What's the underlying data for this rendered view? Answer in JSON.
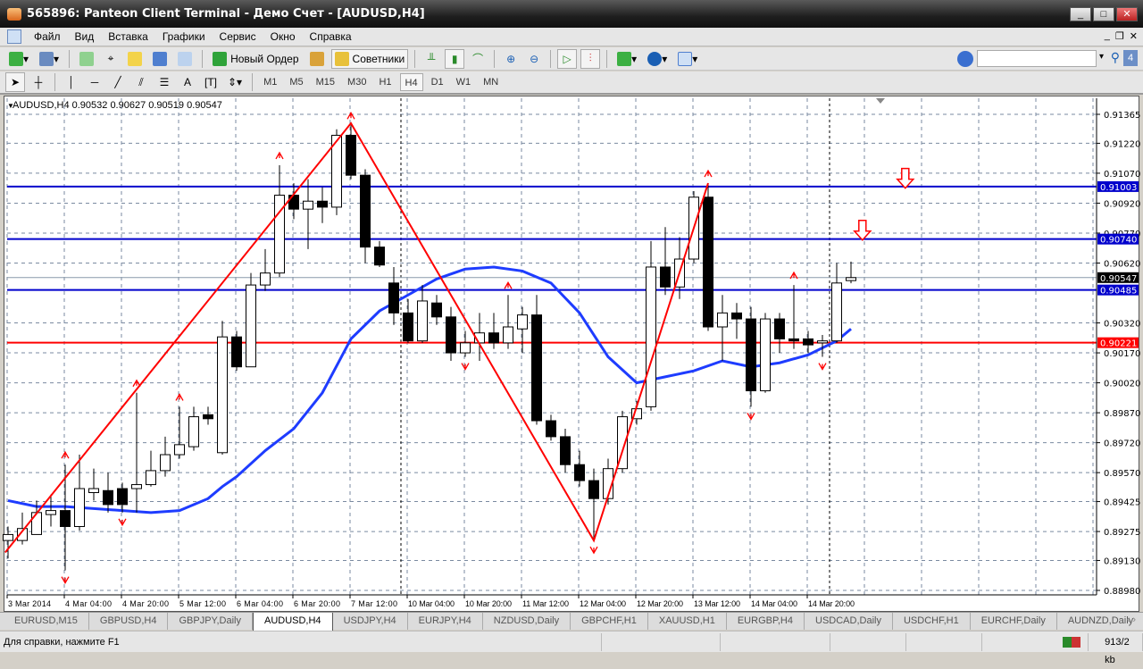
{
  "window": {
    "title": "565896: Panteon Client Terminal - Демо Счет - [AUDUSD,H4]"
  },
  "menu": [
    "Файл",
    "Вид",
    "Вставка",
    "Графики",
    "Сервис",
    "Окно",
    "Справка"
  ],
  "toolbar": {
    "new_order": "Новый Ордер",
    "experts": "Советники",
    "search_placeholder": "",
    "badge": "4"
  },
  "timeframes": [
    "M1",
    "M5",
    "M15",
    "M30",
    "H1",
    "H4",
    "D1",
    "W1",
    "MN"
  ],
  "active_timeframe": "H4",
  "chart_data": {
    "type": "candlestick",
    "symbol_header": "AUDUSD,H4  0.90532 0.90627 0.90519 0.90547",
    "ylim": [
      0.8898,
      0.91365
    ],
    "y_ticks": [
      "0.91365",
      "0.91220",
      "0.91070",
      "0.90920",
      "0.90770",
      "0.90620",
      "0.90320",
      "0.90170",
      "0.90020",
      "0.89870",
      "0.89720",
      "0.89570",
      "0.89425",
      "0.89275",
      "0.89130",
      "0.88980"
    ],
    "x_ticks": [
      {
        "i": 0,
        "label": "3 Mar 2014"
      },
      {
        "i": 4,
        "label": "4 Mar 04:00"
      },
      {
        "i": 8,
        "label": "4 Mar 20:00"
      },
      {
        "i": 12,
        "label": "5 Mar 12:00"
      },
      {
        "i": 16,
        "label": "6 Mar 04:00"
      },
      {
        "i": 20,
        "label": "6 Mar 20:00"
      },
      {
        "i": 24,
        "label": "7 Mar 12:00"
      },
      {
        "i": 28,
        "label": "10 Mar 04:00"
      },
      {
        "i": 32,
        "label": "10 Mar 20:00"
      },
      {
        "i": 36,
        "label": "11 Mar 12:00"
      },
      {
        "i": 40,
        "label": "12 Mar 04:00"
      },
      {
        "i": 44,
        "label": "12 Mar 20:00"
      },
      {
        "i": 48,
        "label": "13 Mar 12:00"
      },
      {
        "i": 52,
        "label": "14 Mar 04:00"
      },
      {
        "i": 56,
        "label": "14 Mar 20:00"
      }
    ],
    "ohlc": [
      [
        0.8923,
        0.893,
        0.8914,
        0.8926
      ],
      [
        0.8923,
        0.8937,
        0.8921,
        0.8929
      ],
      [
        0.8926,
        0.8943,
        0.8926,
        0.8937
      ],
      [
        0.8936,
        0.8946,
        0.893,
        0.8938
      ],
      [
        0.8938,
        0.8961,
        0.8908,
        0.893
      ],
      [
        0.893,
        0.8966,
        0.8928,
        0.8949
      ],
      [
        0.8947,
        0.8959,
        0.8943,
        0.8949
      ],
      [
        0.8948,
        0.8957,
        0.8937,
        0.8941
      ],
      [
        0.8949,
        0.8952,
        0.8937,
        0.8941
      ],
      [
        0.8949,
        0.8997,
        0.8937,
        0.8951
      ],
      [
        0.8951,
        0.8968,
        0.895,
        0.8958
      ],
      [
        0.8958,
        0.8975,
        0.8955,
        0.8966
      ],
      [
        0.8966,
        0.899,
        0.8964,
        0.8971
      ],
      [
        0.897,
        0.899,
        0.8968,
        0.8985
      ],
      [
        0.8986,
        0.899,
        0.8981,
        0.8984
      ],
      [
        0.8967,
        0.9033,
        0.8966,
        0.9025
      ],
      [
        0.9025,
        0.9028,
        0.9008,
        0.901
      ],
      [
        0.901,
        0.9057,
        0.901,
        0.9051
      ],
      [
        0.9051,
        0.9069,
        0.9048,
        0.9057
      ],
      [
        0.9057,
        0.9111,
        0.9055,
        0.9096
      ],
      [
        0.9096,
        0.9102,
        0.9084,
        0.9089
      ],
      [
        0.9089,
        0.9104,
        0.9069,
        0.9093
      ],
      [
        0.9093,
        0.91,
        0.9082,
        0.909
      ],
      [
        0.909,
        0.9129,
        0.9086,
        0.9126
      ],
      [
        0.9126,
        0.9131,
        0.9104,
        0.9106
      ],
      [
        0.9106,
        0.9109,
        0.9062,
        0.907
      ],
      [
        0.907,
        0.9073,
        0.906,
        0.9061
      ],
      [
        0.9052,
        0.906,
        0.9031,
        0.9037
      ],
      [
        0.9037,
        0.9044,
        0.9022,
        0.9023
      ],
      [
        0.9023,
        0.9051,
        0.9022,
        0.9043
      ],
      [
        0.9042,
        0.9046,
        0.9031,
        0.9035
      ],
      [
        0.9035,
        0.904,
        0.9013,
        0.9017
      ],
      [
        0.9017,
        0.9028,
        0.9015,
        0.9022
      ],
      [
        0.9022,
        0.9037,
        0.9013,
        0.9027
      ],
      [
        0.9027,
        0.9037,
        0.9019,
        0.9022
      ],
      [
        0.9022,
        0.9046,
        0.9019,
        0.903
      ],
      [
        0.9029,
        0.904,
        0.9017,
        0.9036
      ],
      [
        0.9036,
        0.9046,
        0.8981,
        0.8983
      ],
      [
        0.8983,
        0.8986,
        0.8973,
        0.8975
      ],
      [
        0.8975,
        0.8979,
        0.8957,
        0.8961
      ],
      [
        0.8961,
        0.8968,
        0.895,
        0.8953
      ],
      [
        0.8953,
        0.8959,
        0.8923,
        0.8944
      ],
      [
        0.8944,
        0.8964,
        0.8941,
        0.8959
      ],
      [
        0.8959,
        0.8988,
        0.8957,
        0.8985
      ],
      [
        0.8984,
        0.8993,
        0.8981,
        0.8989
      ],
      [
        0.899,
        0.9073,
        0.8988,
        0.906
      ],
      [
        0.906,
        0.908,
        0.9046,
        0.905
      ],
      [
        0.905,
        0.9075,
        0.9044,
        0.9064
      ],
      [
        0.9064,
        0.9098,
        0.9062,
        0.9095
      ],
      [
        0.9095,
        0.9102,
        0.9028,
        0.903
      ],
      [
        0.903,
        0.9046,
        0.9013,
        0.9037
      ],
      [
        0.9037,
        0.9042,
        0.9024,
        0.9034
      ],
      [
        0.9034,
        0.904,
        0.899,
        0.8998
      ],
      [
        0.8998,
        0.9037,
        0.8997,
        0.9034
      ],
      [
        0.9034,
        0.9037,
        0.9017,
        0.9024
      ],
      [
        0.9024,
        0.9051,
        0.9019,
        0.9023
      ],
      [
        0.9024,
        0.9028,
        0.9017,
        0.9021
      ],
      [
        0.9022,
        0.9026,
        0.9015,
        0.9023
      ],
      [
        0.9023,
        0.9062,
        0.9022,
        0.9052
      ],
      [
        0.90532,
        0.90627,
        0.90519,
        0.90547
      ]
    ],
    "moving_average": [
      [
        0,
        0.8943
      ],
      [
        2,
        0.894
      ],
      [
        4,
        0.894
      ],
      [
        6,
        0.8939
      ],
      [
        8,
        0.8938
      ],
      [
        10,
        0.8937
      ],
      [
        12,
        0.8938
      ],
      [
        14,
        0.8944
      ],
      [
        15,
        0.895
      ],
      [
        16,
        0.8955
      ],
      [
        18,
        0.8968
      ],
      [
        20,
        0.8979
      ],
      [
        22,
        0.8997
      ],
      [
        24,
        0.9024
      ],
      [
        26,
        0.9038
      ],
      [
        28,
        0.9046
      ],
      [
        30,
        0.9054
      ],
      [
        32,
        0.9059
      ],
      [
        34,
        0.906
      ],
      [
        36,
        0.9058
      ],
      [
        38,
        0.9052
      ],
      [
        40,
        0.9037
      ],
      [
        41,
        0.9026
      ],
      [
        42,
        0.9015
      ],
      [
        44,
        0.9002
      ],
      [
        46,
        0.9005
      ],
      [
        48,
        0.9008
      ],
      [
        50,
        0.9013
      ],
      [
        52,
        0.901
      ],
      [
        54,
        0.9012
      ],
      [
        56,
        0.9016
      ],
      [
        58,
        0.9023
      ],
      [
        59,
        0.9029
      ]
    ],
    "zigzag": [
      [
        -0.2,
        0.8917
      ],
      [
        24,
        0.9132
      ],
      [
        41,
        0.8923
      ],
      [
        49,
        0.9102
      ]
    ],
    "fractals_up": [
      4,
      9,
      12,
      19,
      24,
      35,
      49,
      55
    ],
    "fractals_down": [
      4,
      8,
      32,
      41,
      52,
      57
    ],
    "hlines": [
      {
        "price": 0.91003,
        "label": "0.91003",
        "color": "#0000cc"
      },
      {
        "price": 0.9074,
        "label": "0.90740",
        "color": "#0000cc"
      },
      {
        "price": 0.90485,
        "label": "0.90485",
        "color": "#0000cc"
      },
      {
        "price": 0.90221,
        "label": "0.90221",
        "color": "#ff0000"
      }
    ],
    "bid": {
      "price": 0.90547,
      "label": "0.90547"
    },
    "period_separators": [
      27,
      57
    ],
    "signal_arrows": [
      {
        "i": 62.8,
        "price": 0.9104
      },
      {
        "i": 59.8,
        "price": 0.9078
      }
    ],
    "colors": {
      "ma": "#1e3cff",
      "zigzag": "#ff0000",
      "fractal": "#ff0000",
      "grid": "#7a8aa0"
    }
  },
  "tabs": [
    "EURUSD,M15",
    "GBPUSD,H4",
    "GBPJPY,Daily",
    "AUDUSD,H4",
    "USDJPY,H4",
    "EURJPY,H4",
    "NZDUSD,Daily",
    "GBPCHF,H1",
    "XAUUSD,H1",
    "EURGBP,H4",
    "USDCAD,Daily",
    "USDCHF,H1",
    "EURCHF,Daily",
    "AUDNZD,Daily"
  ],
  "active_tab": "AUDUSD,H4",
  "status": {
    "help": "Для справки, нажмите F1",
    "traffic": "913/2 kb"
  }
}
